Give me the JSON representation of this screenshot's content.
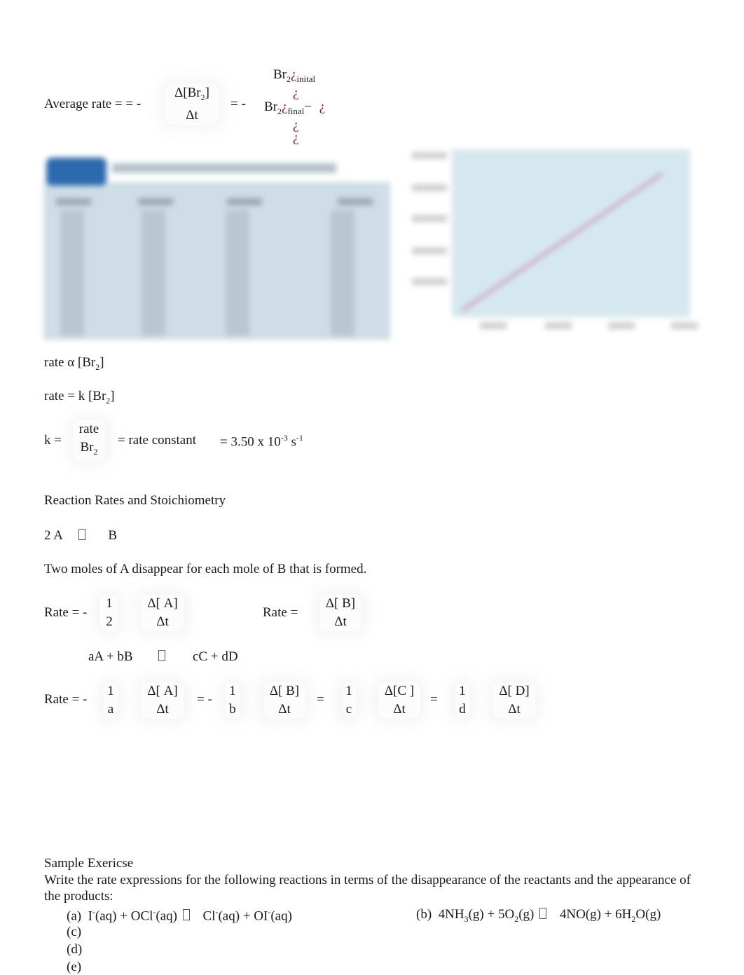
{
  "eq_average_rate": {
    "lead": "Average rate = = -",
    "delta_num": "Δ[Br",
    "delta_num_sub": "2",
    "delta_num_close": "]",
    "delta_den": "Δt",
    "eq2": "= -",
    "garbled_line1_base": "Br",
    "garbled_line1_sub": "2",
    "garbled_glyph": "¿",
    "garbled_line1_label": "inital",
    "garbled_line3_base": "Br",
    "garbled_line3_sub": "2",
    "garbled_line3_label": "final",
    "garbled_line3_minus": "−"
  },
  "figures": {
    "table_figure": "blurred data table figure",
    "chart_figure": "blurred line chart figure"
  },
  "rate_lines": {
    "proportional": {
      "pre": "rate α [Br",
      "sub": "2",
      "post": "]"
    },
    "law": {
      "pre": "rate = k [Br",
      "sub": "2",
      "post": "]"
    },
    "k_lead": "k =",
    "k_num": "rate",
    "k_den": "Br",
    "k_den_sub": "2",
    "k_label": "= rate constant",
    "k_value_pre": "= 3.50 x 10",
    "k_value_exp": "-3",
    "k_value_unit": " s",
    "k_value_unit_exp": "-1"
  },
  "stoich": {
    "heading": "Reaction Rates and Stoichiometry",
    "reaction_left": "2 A",
    "reaction_right": "B",
    "statement": "Two moles of A disappear for each mole of B that is formed.",
    "rate_a_lead": "Rate = -",
    "rate_a_coef_num": "1",
    "rate_a_coef_den": "2",
    "rate_a_num": "Δ[ A]",
    "rate_a_den": "Δt",
    "rate_b_lead": "Rate =",
    "rate_b_num": "Δ[ B]",
    "rate_b_den": "Δt",
    "general_left": "aA + bB",
    "general_right": "cC +  dD",
    "general_rate": {
      "lead": "Rate = -",
      "terms": [
        {
          "coef_num": "1",
          "coef_den": "a",
          "num": "Δ[ A]",
          "den": "Δt",
          "sep": "= -"
        },
        {
          "coef_num": "1",
          "coef_den": "b",
          "num": "Δ[ B]",
          "den": "Δt",
          "sep": "="
        },
        {
          "coef_num": "1",
          "coef_den": "c",
          "num": "Δ[C ]",
          "den": "Δt",
          "sep": "="
        },
        {
          "coef_num": "1",
          "coef_den": "d",
          "num": "Δ[ D]",
          "den": "Δt",
          "sep": ""
        }
      ]
    }
  },
  "exercise": {
    "title": "Sample Exericse",
    "prompt": "Write the rate expressions for the following reactions in terms of the disappearance of the reactants and the appearance of the products:",
    "items": [
      {
        "label": "(a)",
        "text_parts": [
          "I",
          "-",
          "(aq) + OCl",
          "-",
          "(aq)",
          "Cl",
          "-",
          "(aq) + OI",
          "-",
          "(aq)"
        ]
      },
      {
        "label": "(b)",
        "text_parts": [
          "4NH",
          "3",
          "(g) + 5O",
          "2",
          "(g)",
          "4NO(g) + 6H",
          "2",
          "O(g)"
        ]
      },
      {
        "label": "(c)"
      },
      {
        "label": "(d)"
      },
      {
        "label": "(e)"
      }
    ]
  }
}
